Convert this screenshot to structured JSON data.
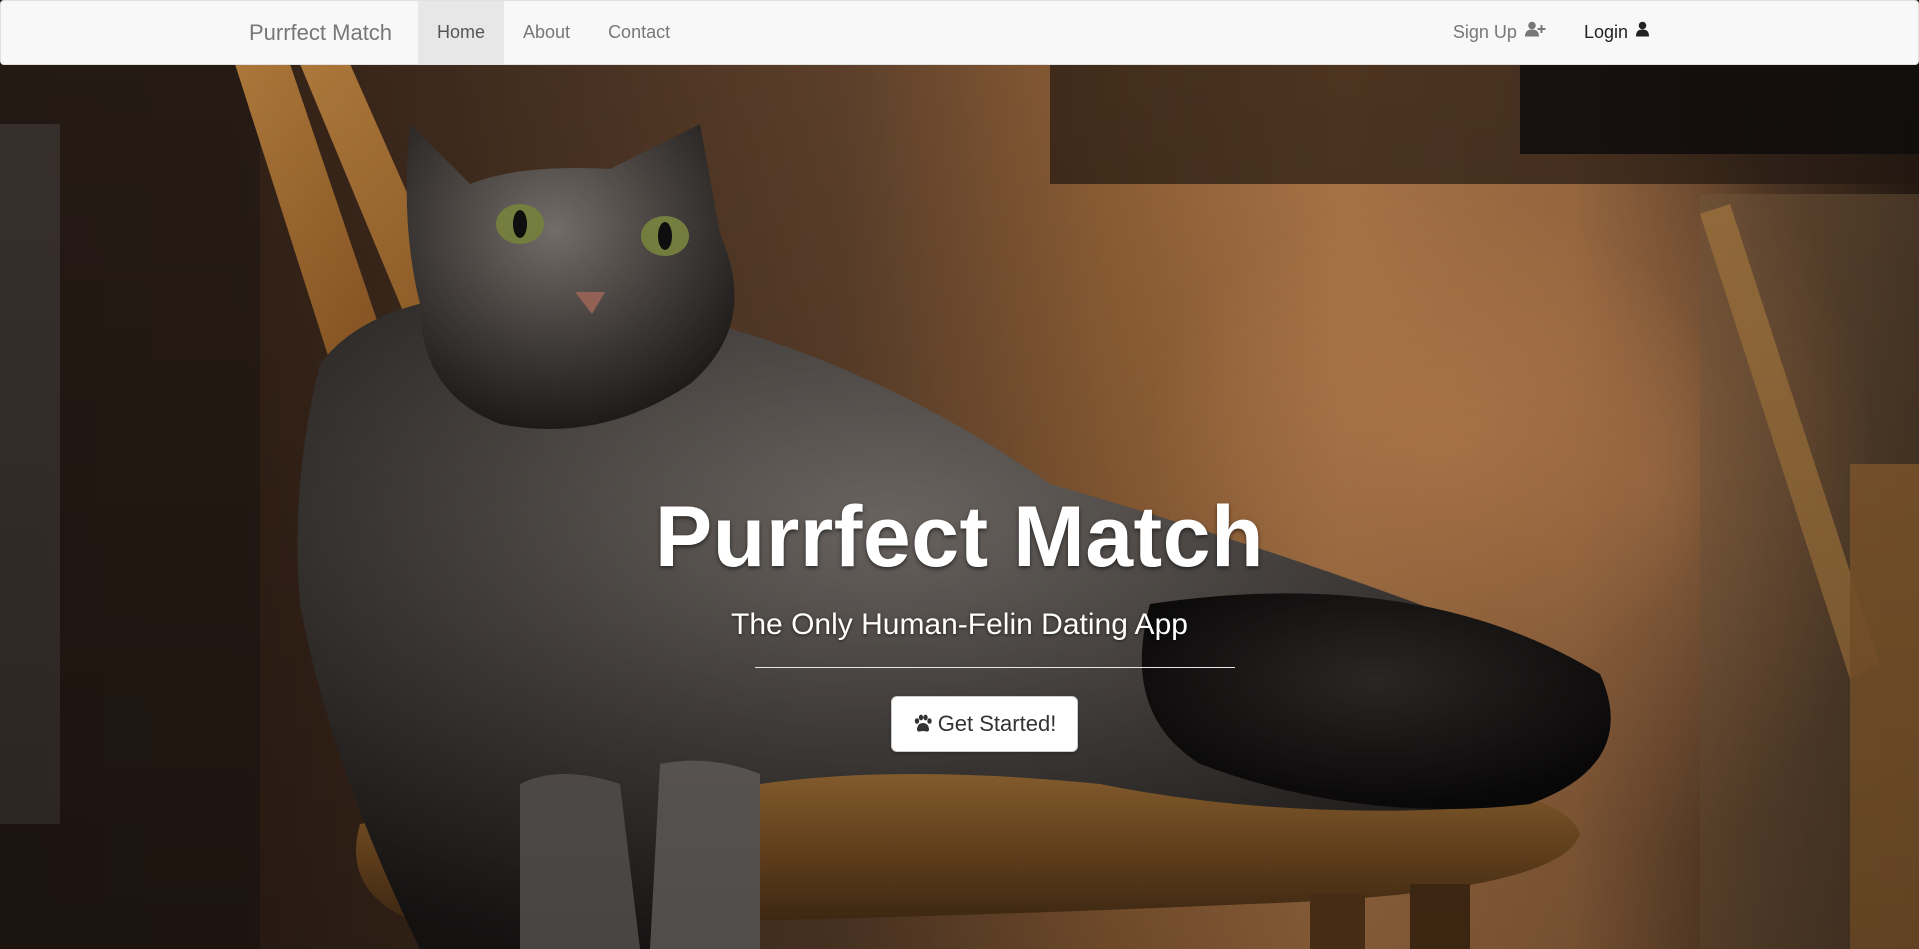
{
  "navbar": {
    "brand": "Purrfect Match",
    "left_items": [
      {
        "label": "Home",
        "active": true
      },
      {
        "label": "About",
        "active": false
      },
      {
        "label": "Contact",
        "active": false
      }
    ],
    "right_items": [
      {
        "label": "Sign Up",
        "icon": "user-plus-icon"
      },
      {
        "label": "Login",
        "icon": "user-icon"
      }
    ]
  },
  "hero": {
    "title": "Purrfect Match",
    "subtitle": "The Only Human-Felin Dating App",
    "cta_label": "Get Started!",
    "cta_icon": "paw-icon",
    "background_image": "tabby-cat-on-wooden-chair"
  },
  "colors": {
    "navbar_bg": "#f8f8f8",
    "nav_text": "#777777",
    "nav_active_bg": "#e7e7e7",
    "hero_text": "#ffffff",
    "button_bg": "#ffffff"
  }
}
